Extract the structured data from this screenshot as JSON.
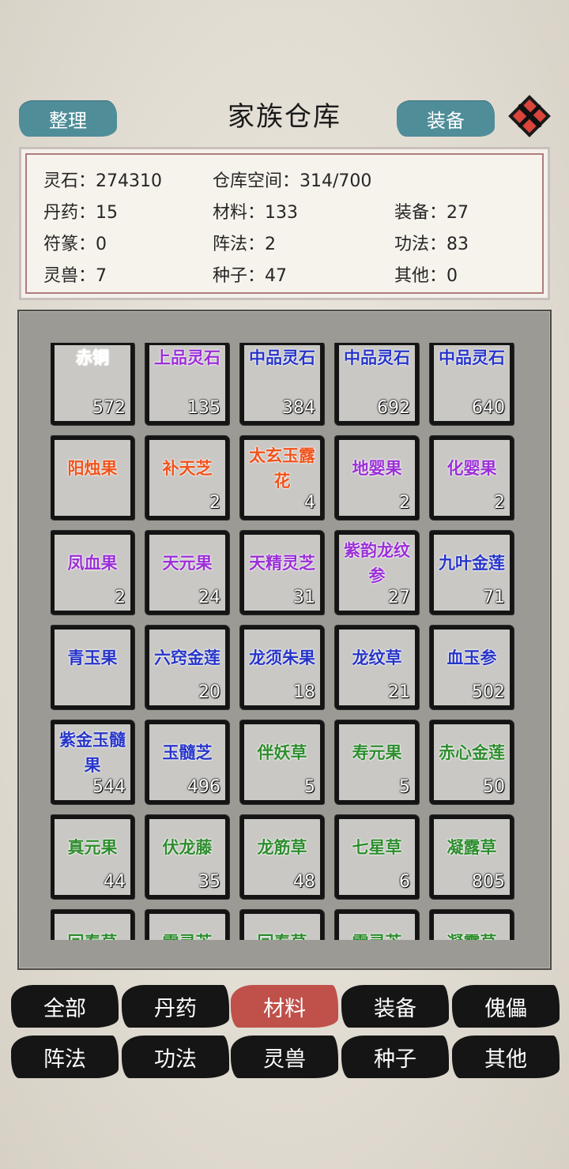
{
  "header": {
    "title": "家族仓库",
    "sort_label": "整理",
    "equip_label": "装备"
  },
  "stats": {
    "spirit_stone": "灵石：274310",
    "storage": "仓库空间：314/700",
    "pills": "丹药：15",
    "materials": "材料：133",
    "equipment": "装备：27",
    "talismans": "符篆：0",
    "formations": "阵法：2",
    "techniques": "功法：83",
    "beasts": "灵兽：7",
    "seeds": "种子：47",
    "others": "其他：0"
  },
  "colors": {
    "white": "#ffffff",
    "purple": "#9a2fd6",
    "blue": "#2735c8",
    "orange": "#f0531c",
    "green": "#2e8c2e",
    "accent_teal": "#4f8d99",
    "active_tab": "#c0504a"
  },
  "items": [
    {
      "name": "赤铜",
      "count": "572",
      "color": "#ffffff"
    },
    {
      "name": "上品灵石",
      "count": "135",
      "color": "#9a2fd6"
    },
    {
      "name": "中品灵石",
      "count": "384",
      "color": "#2735c8"
    },
    {
      "name": "中品灵石",
      "count": "692",
      "color": "#2735c8"
    },
    {
      "name": "中品灵石",
      "count": "640",
      "color": "#2735c8"
    },
    {
      "name": "阳烛果",
      "count": "",
      "color": "#f0531c"
    },
    {
      "name": "补天芝",
      "count": "2",
      "color": "#f0531c"
    },
    {
      "name": "太玄玉露花",
      "count": "4",
      "color": "#f0531c"
    },
    {
      "name": "地婴果",
      "count": "2",
      "color": "#9a2fd6"
    },
    {
      "name": "化婴果",
      "count": "2",
      "color": "#9a2fd6"
    },
    {
      "name": "凤血果",
      "count": "2",
      "color": "#9a2fd6"
    },
    {
      "name": "天元果",
      "count": "24",
      "color": "#9a2fd6"
    },
    {
      "name": "天精灵芝",
      "count": "31",
      "color": "#9a2fd6"
    },
    {
      "name": "紫韵龙纹参",
      "count": "27",
      "color": "#9a2fd6"
    },
    {
      "name": "九叶金莲",
      "count": "71",
      "color": "#2735c8"
    },
    {
      "name": "青玉果",
      "count": "",
      "color": "#2735c8"
    },
    {
      "name": "六窍金莲",
      "count": "20",
      "color": "#2735c8"
    },
    {
      "name": "龙须朱果",
      "count": "18",
      "color": "#2735c8"
    },
    {
      "name": "龙纹草",
      "count": "21",
      "color": "#2735c8"
    },
    {
      "name": "血玉参",
      "count": "502",
      "color": "#2735c8"
    },
    {
      "name": "紫金玉髓果",
      "count": "544",
      "color": "#2735c8"
    },
    {
      "name": "玉髓芝",
      "count": "496",
      "color": "#2735c8"
    },
    {
      "name": "伴妖草",
      "count": "5",
      "color": "#2e8c2e"
    },
    {
      "name": "寿元果",
      "count": "5",
      "color": "#2e8c2e"
    },
    {
      "name": "赤心金莲",
      "count": "50",
      "color": "#2e8c2e"
    },
    {
      "name": "真元果",
      "count": "44",
      "color": "#2e8c2e"
    },
    {
      "name": "伏龙藤",
      "count": "35",
      "color": "#2e8c2e"
    },
    {
      "name": "龙筋草",
      "count": "48",
      "color": "#2e8c2e"
    },
    {
      "name": "七星草",
      "count": "6",
      "color": "#2e8c2e"
    },
    {
      "name": "凝露草",
      "count": "805",
      "color": "#2e8c2e"
    },
    {
      "name": "回春草",
      "count": "",
      "color": "#2e8c2e"
    },
    {
      "name": "雪灵芝",
      "count": "",
      "color": "#2e8c2e"
    },
    {
      "name": "回春草",
      "count": "",
      "color": "#2e8c2e"
    },
    {
      "name": "雪灵芝",
      "count": "",
      "color": "#2e8c2e"
    },
    {
      "name": "凝露草",
      "count": "",
      "color": "#2e8c2e"
    }
  ],
  "tabs": [
    {
      "label": "全部",
      "active": false
    },
    {
      "label": "丹药",
      "active": false
    },
    {
      "label": "材料",
      "active": true
    },
    {
      "label": "装备",
      "active": false
    },
    {
      "label": "傀儡",
      "active": false
    },
    {
      "label": "阵法",
      "active": false
    },
    {
      "label": "功法",
      "active": false
    },
    {
      "label": "灵兽",
      "active": false
    },
    {
      "label": "种子",
      "active": false
    },
    {
      "label": "其他",
      "active": false
    }
  ],
  "icons": {
    "close": "close-icon"
  }
}
